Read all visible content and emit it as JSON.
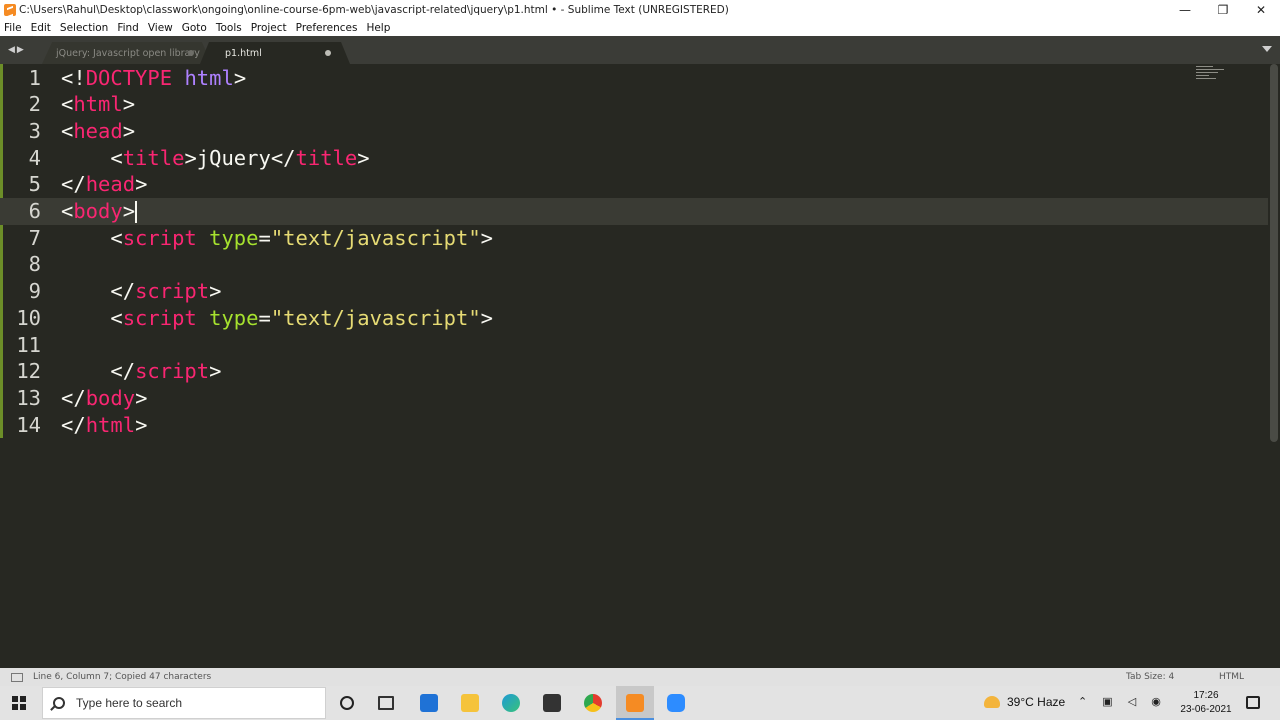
{
  "window": {
    "title": "C:\\Users\\Rahul\\Desktop\\classwork\\ongoing\\online-course-6pm-web\\javascript-related\\jquery\\p1.html • - Sublime Text (UNREGISTERED)",
    "minimize": "—",
    "maximize": "❐",
    "close": "✕"
  },
  "menu": [
    "File",
    "Edit",
    "Selection",
    "Find",
    "View",
    "Goto",
    "Tools",
    "Project",
    "Preferences",
    "Help"
  ],
  "tabs": [
    {
      "label": "jQuery: Javascript open library",
      "active": false
    },
    {
      "label": "p1.html",
      "active": true
    }
  ],
  "editor": {
    "current_line": 6,
    "lines": [
      {
        "num": "1",
        "tokens": [
          [
            "p",
            "<!"
          ],
          [
            "t",
            "DOCTYPE"
          ],
          [
            "p",
            " "
          ],
          [
            "k",
            "html"
          ],
          [
            "p",
            ">"
          ]
        ]
      },
      {
        "num": "2",
        "tokens": [
          [
            "p",
            "<"
          ],
          [
            "t",
            "html"
          ],
          [
            "p",
            ">"
          ]
        ]
      },
      {
        "num": "3",
        "tokens": [
          [
            "p",
            "<"
          ],
          [
            "t",
            "head"
          ],
          [
            "p",
            ">"
          ]
        ]
      },
      {
        "num": "4",
        "tokens": [
          [
            "p",
            "    <"
          ],
          [
            "t",
            "title"
          ],
          [
            "p",
            ">jQuery</"
          ],
          [
            "t",
            "title"
          ],
          [
            "p",
            ">"
          ]
        ]
      },
      {
        "num": "5",
        "tokens": [
          [
            "p",
            "</"
          ],
          [
            "t",
            "head"
          ],
          [
            "p",
            ">"
          ]
        ]
      },
      {
        "num": "6",
        "tokens": [
          [
            "p",
            "<"
          ],
          [
            "t",
            "body"
          ],
          [
            "p",
            ">"
          ]
        ]
      },
      {
        "num": "7",
        "tokens": [
          [
            "p",
            "    <"
          ],
          [
            "t",
            "script"
          ],
          [
            "p",
            " "
          ],
          [
            "a",
            "type"
          ],
          [
            "p",
            "="
          ],
          [
            "s",
            "\"text/javascript\""
          ],
          [
            "p",
            ">"
          ]
        ]
      },
      {
        "num": "8",
        "tokens": []
      },
      {
        "num": "9",
        "tokens": [
          [
            "p",
            "    </"
          ],
          [
            "t",
            "script"
          ],
          [
            "p",
            ">"
          ]
        ]
      },
      {
        "num": "10",
        "tokens": [
          [
            "p",
            "    <"
          ],
          [
            "t",
            "script"
          ],
          [
            "p",
            " "
          ],
          [
            "a",
            "type"
          ],
          [
            "p",
            "="
          ],
          [
            "s",
            "\"text/javascript\""
          ],
          [
            "p",
            ">"
          ]
        ]
      },
      {
        "num": "11",
        "tokens": []
      },
      {
        "num": "12",
        "tokens": [
          [
            "p",
            "    </"
          ],
          [
            "t",
            "script"
          ],
          [
            "p",
            ">"
          ]
        ]
      },
      {
        "num": "13",
        "tokens": [
          [
            "p",
            "</"
          ],
          [
            "t",
            "body"
          ],
          [
            "p",
            ">"
          ]
        ]
      },
      {
        "num": "14",
        "tokens": [
          [
            "p",
            "</"
          ],
          [
            "t",
            "html"
          ],
          [
            "p",
            ">"
          ]
        ]
      }
    ]
  },
  "status": {
    "message": "Line 6, Column 7; Copied 47 characters",
    "tab_size": "Tab Size: 4",
    "syntax": "HTML"
  },
  "taskbar": {
    "search_placeholder": "Type here to search",
    "weather": "39°C  Haze",
    "time": "17:26",
    "date": "23-06-2021"
  }
}
